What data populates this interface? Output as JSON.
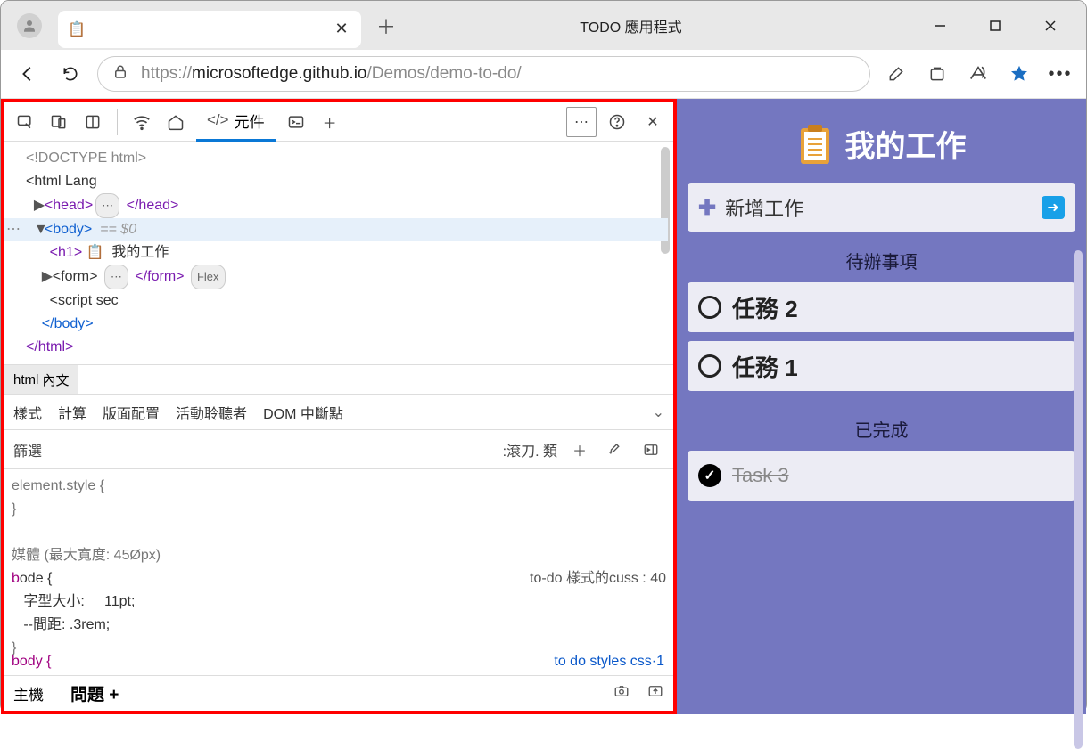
{
  "window": {
    "app_label": "TODO 應用程式",
    "tab_title": ""
  },
  "addressbar": {
    "url_prefix": "https://",
    "url_host": "microsoftedge.github.io",
    "url_path": "/Demos/demo-to-do/"
  },
  "devtools": {
    "elements_tab": "元件",
    "dom": {
      "doctype": "<!DOCTYPE html>",
      "html_open": "<html Lang",
      "head_open": "<head>",
      "head_ellipsis": "⋯",
      "head_close": "</head>",
      "body_open": "<body>",
      "body_eq": "== $0",
      "h1_open": "<h1>",
      "h1_text": "我的工作",
      "form_open": "<form>",
      "form_close": "</form>",
      "form_badge": "Flex",
      "script_line": "<script sec",
      "body_close": "</body>",
      "html_close": "</html>"
    },
    "breadcrumb": [
      "html",
      "內文"
    ],
    "panel_tabs": [
      "樣式",
      "計算",
      "版面配置",
      "活動聆聽者",
      "DOM 中斷點"
    ],
    "filter_label": "篩選",
    "hover_label": ":滾刀. 類",
    "styles": {
      "element_style": "element.style {",
      "close_brace": "}",
      "media": "媒體 (最大寬度: 45Øpx)",
      "body_sel": "ode {",
      "src_ref": "to-do 樣式的cuss : 40",
      "prop1_name": "字型大小:",
      "prop1_val": "11pt;",
      "prop2": "--間距: .3rem;",
      "cutoff_left": "body {",
      "cutoff_right": "to-do styles css:1"
    },
    "drawer": {
      "host": "主機",
      "issues": "問題 +"
    }
  },
  "app": {
    "title": "我的工作",
    "add_placeholder": "新增工作",
    "section_pending": "待辦事項",
    "section_done": "已完成",
    "tasks_pending": [
      "任務 2",
      "任務 1"
    ],
    "tasks_done": [
      "Task 3"
    ]
  }
}
